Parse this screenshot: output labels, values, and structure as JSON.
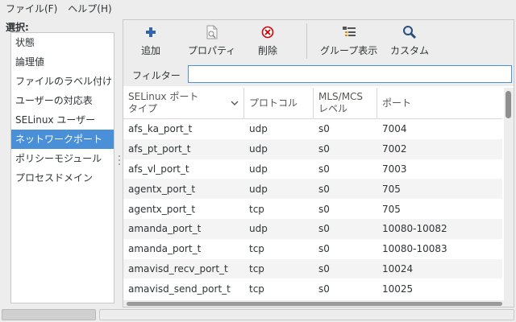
{
  "menubar": {
    "items": [
      {
        "label": "ファイル(F)"
      },
      {
        "label": "ヘルプ(H)"
      }
    ]
  },
  "sidebar": {
    "heading": "選択:",
    "items": [
      {
        "label": "状態"
      },
      {
        "label": "論理値"
      },
      {
        "label": "ファイルのラベル付け"
      },
      {
        "label": "ユーザーの対応表"
      },
      {
        "label": "SELinux ユーザー"
      },
      {
        "label": "ネットワークポート",
        "selected": true
      },
      {
        "label": "ポリシーモジュール"
      },
      {
        "label": "プロセスドメイン"
      }
    ]
  },
  "toolbar": {
    "add_label": "追加",
    "properties_label": "プロパティ",
    "delete_label": "削除",
    "group_view_label": "グループ表示",
    "custom_label": "カスタム"
  },
  "filter": {
    "label": "フィルター",
    "value": ""
  },
  "table": {
    "headers": {
      "type_line1": "SELinux ポート",
      "type_line2": "タイプ",
      "protocol": "プロトコル",
      "mls_line1": "MLS/MCS",
      "mls_line2": "レベル",
      "port": "ポート"
    },
    "rows": [
      {
        "type": "afs_ka_port_t",
        "protocol": "udp",
        "mls": "s0",
        "port": "7004"
      },
      {
        "type": "afs_pt_port_t",
        "protocol": "udp",
        "mls": "s0",
        "port": "7002"
      },
      {
        "type": "afs_vl_port_t",
        "protocol": "udp",
        "mls": "s0",
        "port": "7003"
      },
      {
        "type": "agentx_port_t",
        "protocol": "udp",
        "mls": "s0",
        "port": "705"
      },
      {
        "type": "agentx_port_t",
        "protocol": "tcp",
        "mls": "s0",
        "port": "705"
      },
      {
        "type": "amanda_port_t",
        "protocol": "udp",
        "mls": "s0",
        "port": "10080-10082"
      },
      {
        "type": "amanda_port_t",
        "protocol": "tcp",
        "mls": "s0",
        "port": "10080-10083"
      },
      {
        "type": "amavisd_recv_port_t",
        "protocol": "tcp",
        "mls": "s0",
        "port": "10024"
      },
      {
        "type": "amavisd_send_port_t",
        "protocol": "tcp",
        "mls": "s0",
        "port": "10025"
      }
    ]
  },
  "colors": {
    "selection": "#4a90d9",
    "add_icon": "#3465a4",
    "delete_icon": "#cc0000"
  },
  "icons": {
    "add": "plus-icon",
    "properties": "properties-icon",
    "delete": "delete-circle-icon",
    "group_view": "group-list-icon",
    "custom": "magnifier-icon",
    "sort": "chevron-down-icon"
  }
}
